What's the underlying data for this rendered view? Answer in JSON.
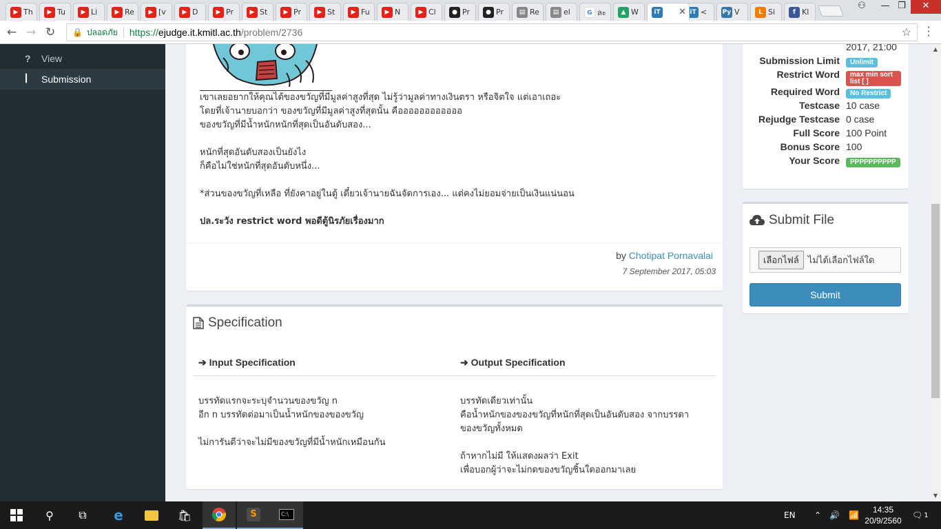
{
  "browser": {
    "tabs": [
      {
        "label": "Th",
        "icon": "youtube-icon"
      },
      {
        "label": "Tu",
        "icon": "youtube-icon"
      },
      {
        "label": "Li",
        "icon": "youtube-icon"
      },
      {
        "label": "Re",
        "icon": "youtube-icon"
      },
      {
        "label": "[v",
        "icon": "youtube-icon"
      },
      {
        "label": "D",
        "icon": "youtube-icon"
      },
      {
        "label": "Pr",
        "icon": "youtube-icon"
      },
      {
        "label": "St",
        "icon": "youtube-icon"
      },
      {
        "label": "Pr",
        "icon": "youtube-icon"
      },
      {
        "label": "St",
        "icon": "youtube-icon"
      },
      {
        "label": "Fu",
        "icon": "youtube-icon"
      },
      {
        "label": "N",
        "icon": "youtube-icon"
      },
      {
        "label": "Cl",
        "icon": "youtube-icon"
      },
      {
        "label": "Pr",
        "icon": "github-icon"
      },
      {
        "label": "Pr",
        "icon": "github-icon"
      },
      {
        "label": "Re",
        "icon": "page-icon"
      },
      {
        "label": "el",
        "icon": "page-icon"
      },
      {
        "label": "ละ",
        "icon": "google-icon"
      },
      {
        "label": "W",
        "icon": "drive-icon"
      },
      {
        "label": "",
        "icon": "ejudge-icon",
        "active": true
      },
      {
        "label": "<",
        "icon": "ejudge-icon"
      },
      {
        "label": "V",
        "icon": "python-icon"
      },
      {
        "label": "Si",
        "icon": "orange-page-icon"
      },
      {
        "label": "Kl",
        "icon": "facebook-icon"
      }
    ],
    "address": {
      "secure_label": "ปลอดภัย",
      "url_scheme": "https://",
      "url_host": "ejudge.it.kmitl.ac.th",
      "url_path": "/problem/2736"
    }
  },
  "sidebar": {
    "items": [
      {
        "label": "View",
        "icon": "question-icon",
        "selected": false
      },
      {
        "label": "Submission",
        "icon": "code-fork-icon",
        "selected": true
      }
    ]
  },
  "problem": {
    "lines": [
      "เขาเลยอยากให้คุณได้ของขวัญที่มีมูลค่าสูงที่สุด ไม่รู้ว่ามูลค่าทางเงินตรา หรือจิตใจ แต่เอาเถอะ",
      "โดยที่เจ้านายบอกว่า ของขวัญที่มีมูลค่าสูงที่สุดนั้น คืออออออออออออ",
      "ของขวัญที่มีน้ำหนักหนักที่สุดเป็นอันดับสอง...",
      "หนักที่สุดอันดับสองเป็นยังไง",
      "ก็คือไม่ใช่หนักที่สุดอันดับหนึ่ง...",
      "*ส่วนของขวัญที่เหลือ ที่ยังคาอยู่ในตู้ เดี๋ยวเจ้านายฉันจัดการเอง... แต่คงไม่ยอมจ่ายเป็นเงินแน่นอน",
      "ปล.ระวัง restrict word พอดีตู้นิรภัยเรื่องมาก"
    ],
    "by_prefix": "by",
    "author": "Chotipat Pornavalai",
    "date": "7 September 2017, 05:03"
  },
  "specification": {
    "title": "Specification",
    "input_title": "Input Specification",
    "output_title": "Output Specification",
    "input_lines": [
      "บรรทัดแรกจะระบุจำนวนของขวัญ n",
      "อีก n บรรทัดต่อมาเป็นน้ำหนักของของขวัญ",
      "ไม่การันตีว่าจะไม่มีของขวัญที่มีน้ำหนักเหมือนกัน"
    ],
    "output_lines": [
      "บรรทัดเดียวเท่านั้น",
      "คือน้ำหนักของของขวัญที่หนักที่สุดเป็นอันดับสอง จากบรรดา",
      "ของขวัญทั้งหมด",
      "ถ้าหากไม่มี ให้แสดงผลว่า Exit",
      "เพื่อบอกผู้ว่าจะไม่กดของขวัญชิ้นใดออกมาเลย"
    ]
  },
  "info": {
    "deadline_partial": "2017, 21:00",
    "rows": [
      {
        "label": "Submission Limit",
        "value": "Unlimit",
        "type": "badge",
        "color": "#5bc0de"
      },
      {
        "label": "Restrict Word",
        "value": "max min sort list [ ]",
        "type": "badge",
        "color": "#d9534f"
      },
      {
        "label": "Required Word",
        "value": "No Restrict",
        "type": "badge",
        "color": "#5bc0de"
      },
      {
        "label": "Testcase",
        "value": "10 case",
        "type": "text"
      },
      {
        "label": "Rejudge Testcase",
        "value": "0 case",
        "type": "text"
      },
      {
        "label": "Full Score",
        "value": "100 Point",
        "type": "text"
      },
      {
        "label": "Bonus Score",
        "value": "100",
        "type": "text"
      },
      {
        "label": "Your Score",
        "value": "PPPPPPPPPP",
        "type": "badge",
        "color": "#5cb85c"
      }
    ]
  },
  "submit": {
    "title": "Submit File",
    "file_button": "เลือกไฟล์",
    "file_status": "ไม่ได้เลือกไฟล์ใด",
    "submit_label": "Submit"
  },
  "taskbar": {
    "language": "EN",
    "time": "14:35",
    "date": "20/9/2560",
    "notifications": "1"
  }
}
